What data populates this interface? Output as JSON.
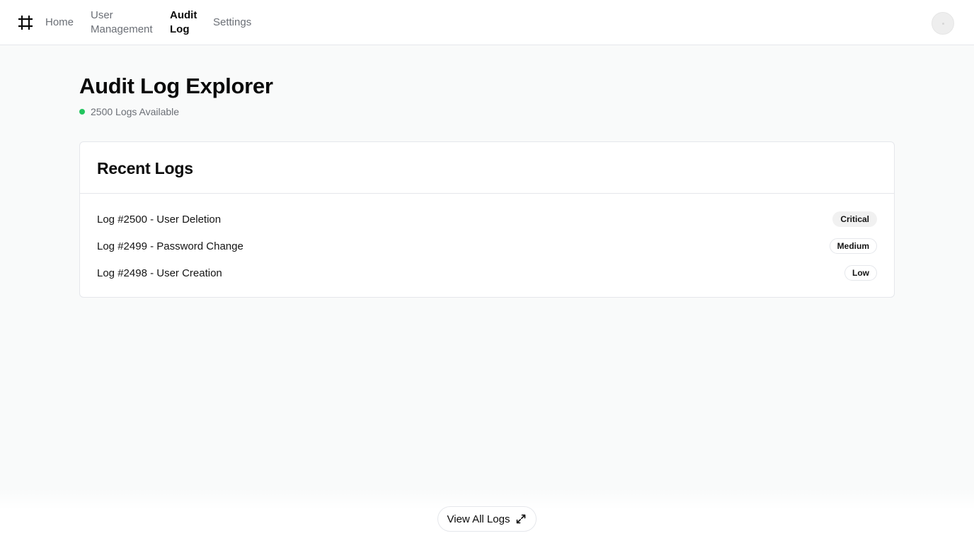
{
  "nav": {
    "logo_icon": "hash-icon",
    "items": [
      {
        "label": "Home",
        "active": false
      },
      {
        "label": "User\nManagement",
        "active": false
      },
      {
        "label": "Audit\nLog",
        "active": true
      },
      {
        "label": "Settings",
        "active": false
      }
    ],
    "avatar_icon": "user-avatar"
  },
  "page": {
    "title": "Audit Log Explorer",
    "status_text": "2500 Logs Available",
    "status_color": "#22c55e"
  },
  "card": {
    "title": "Recent Logs",
    "logs": [
      {
        "text": "Log #2500 - User Deletion",
        "severity": "Critical"
      },
      {
        "text": "Log #2499 - Password Change",
        "severity": "Medium"
      },
      {
        "text": "Log #2498 - User Creation",
        "severity": "Low"
      }
    ]
  },
  "footer": {
    "view_all_label": "View All Logs",
    "view_all_icon": "expand-arrows-icon"
  }
}
